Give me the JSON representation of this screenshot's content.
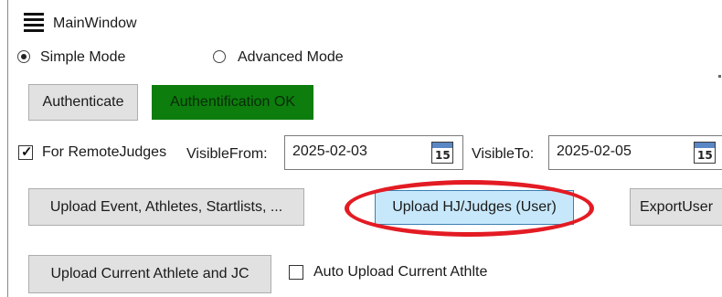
{
  "window": {
    "title": "MainWindow"
  },
  "mode": {
    "simple_label": "Simple Mode",
    "advanced_label": "Advanced Mode",
    "selected": "Simple Mode"
  },
  "auth": {
    "button_label": "Authenticate",
    "status_text": "Authentification OK",
    "status_color": "#0d7d0d"
  },
  "remote": {
    "checkbox_label": "For RemoteJudges",
    "checked": true,
    "visible_from_label": "VisibleFrom:",
    "visible_from_value": "2025-02-03",
    "visible_to_label": "VisibleTo:",
    "visible_to_value": "2025-02-05",
    "calendar_day": "15"
  },
  "uploads": {
    "event_button": "Upload Event, Athletes, Startlists, ...",
    "hj_button": "Upload HJ/Judges (User)",
    "export_button": "ExportUser",
    "current_button": "Upload Current Athlete and JC",
    "auto_upload_label": "Auto Upload Current Athlte",
    "auto_upload_checked": false
  },
  "annotation": {
    "color": "#e31b23"
  }
}
